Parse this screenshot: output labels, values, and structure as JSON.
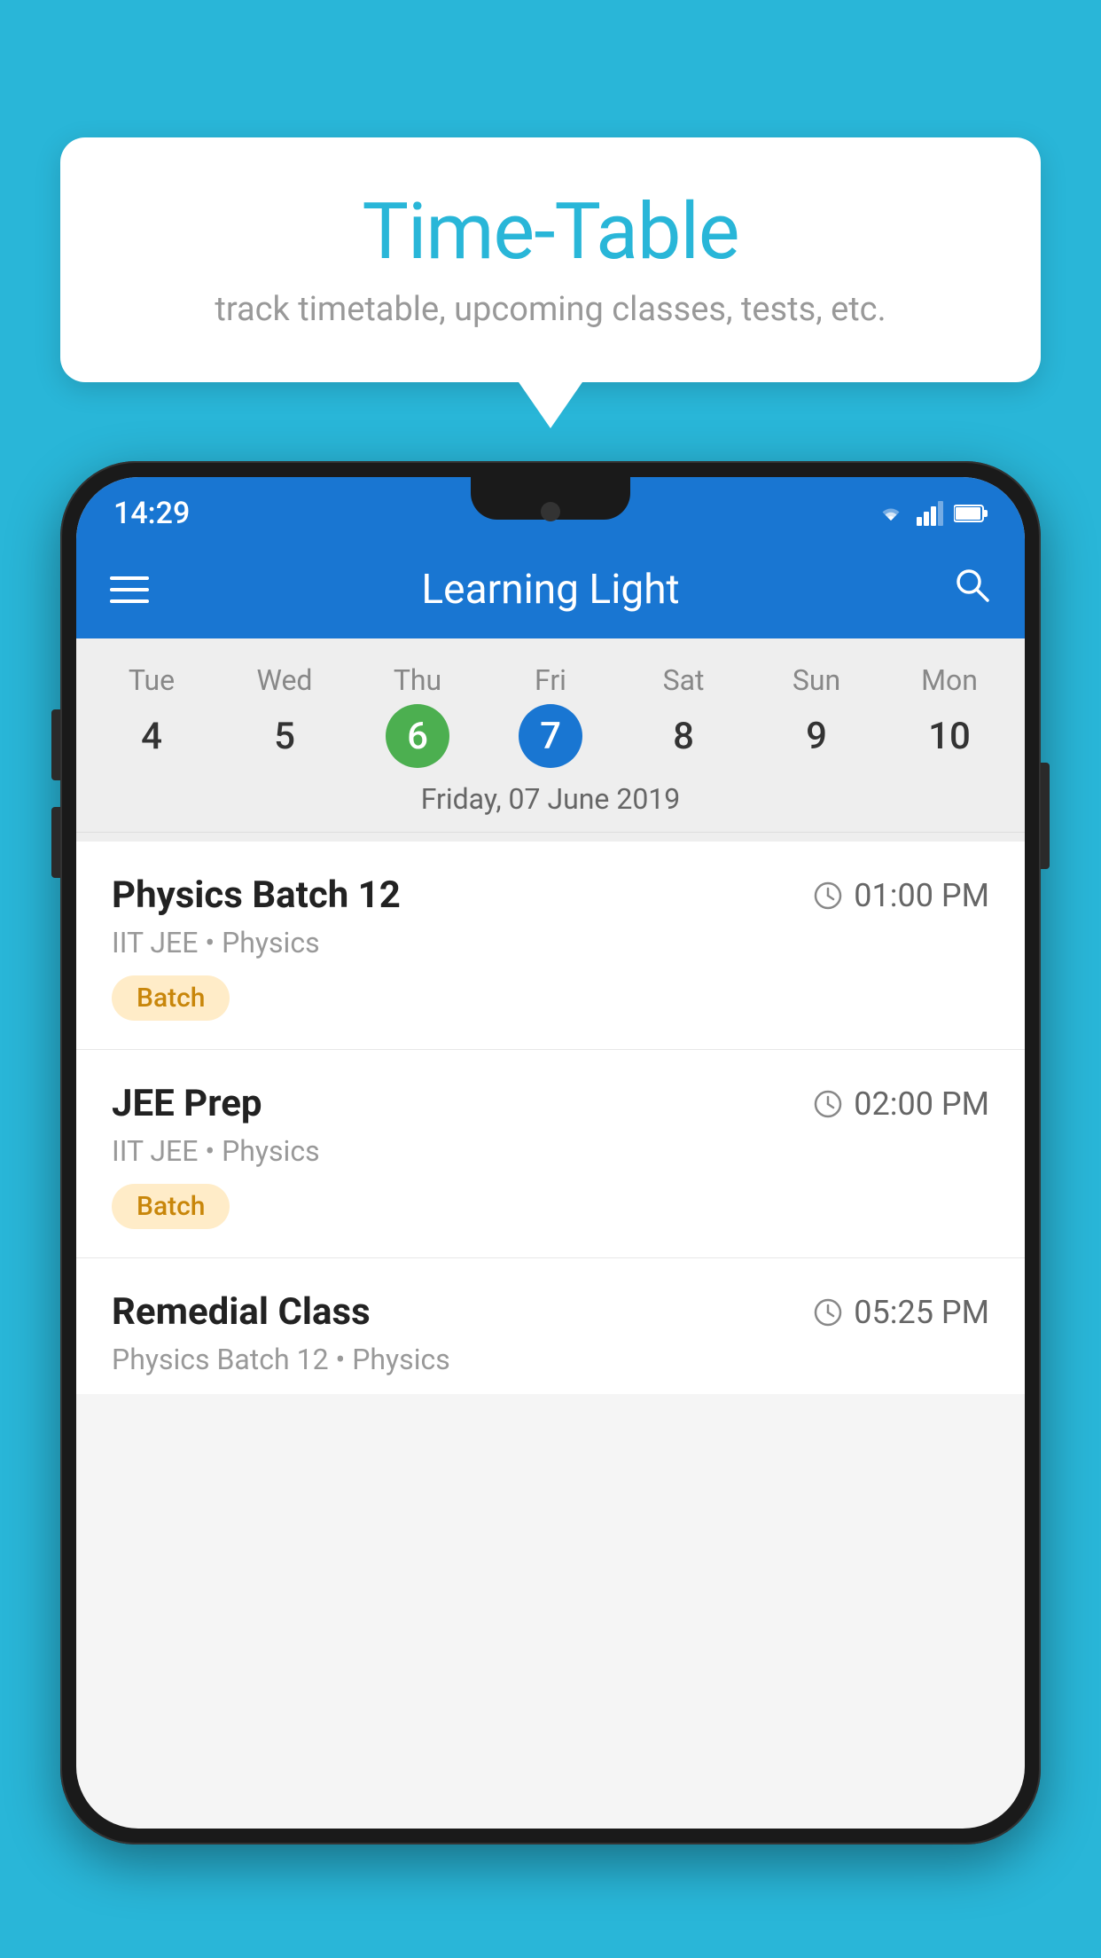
{
  "page": {
    "background_color": "#29b6d8"
  },
  "bubble": {
    "title": "Time-Table",
    "subtitle": "track timetable, upcoming classes, tests, etc."
  },
  "phone": {
    "status_bar": {
      "time": "14:29"
    },
    "app_bar": {
      "title": "Learning Light"
    },
    "calendar": {
      "days": [
        "Tue",
        "Wed",
        "Thu",
        "Fri",
        "Sat",
        "Sun",
        "Mon"
      ],
      "dates": [
        "4",
        "5",
        "6",
        "7",
        "8",
        "9",
        "10"
      ],
      "today_index": 2,
      "selected_index": 3,
      "selected_date_label": "Friday, 07 June 2019"
    },
    "schedule": [
      {
        "title": "Physics Batch 12",
        "time": "01:00 PM",
        "subtitle": "IIT JEE • Physics",
        "badge": "Batch"
      },
      {
        "title": "JEE Prep",
        "time": "02:00 PM",
        "subtitle": "IIT JEE • Physics",
        "badge": "Batch"
      },
      {
        "title": "Remedial Class",
        "time": "05:25 PM",
        "subtitle": "Physics Batch 12 • Physics"
      }
    ]
  }
}
